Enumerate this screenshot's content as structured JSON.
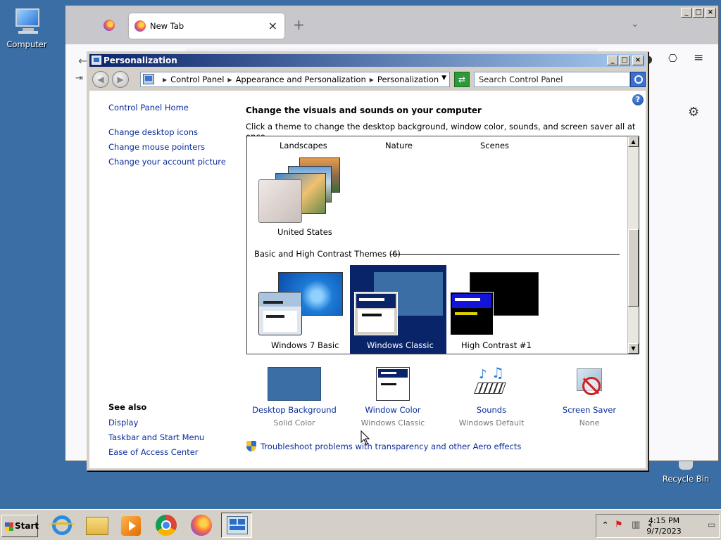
{
  "desktop": {
    "computer_label": "Computer",
    "recycle_label": "Recycle Bin"
  },
  "browser": {
    "tab_title": "New Tab"
  },
  "window": {
    "title": "Personalization",
    "breadcrumb": [
      "Control Panel",
      "Appearance and Personalization",
      "Personalization"
    ],
    "search_placeholder": "Search Control Panel"
  },
  "sidebar": {
    "home": "Control Panel Home",
    "links": [
      "Change desktop icons",
      "Change mouse pointers",
      "Change your account picture"
    ],
    "see_also_title": "See also",
    "see_also": [
      "Display",
      "Taskbar and Start Menu",
      "Ease of Access Center"
    ]
  },
  "main": {
    "heading": "Change the visuals and sounds on your computer",
    "subheading": "Click a theme to change the desktop background, window color, sounds, and screen saver all at once.",
    "categories": [
      "Landscapes",
      "Nature",
      "Scenes"
    ],
    "united_states_label": "United States",
    "basic_group_label": "Basic and High Contrast Themes (6)",
    "basic_themes": [
      "Windows 7 Basic",
      "Windows Classic",
      "High Contrast #1"
    ],
    "selected_theme": "Windows Classic"
  },
  "settings": [
    {
      "label": "Desktop Background",
      "value": "Solid Color"
    },
    {
      "label": "Window Color",
      "value": "Windows Classic"
    },
    {
      "label": "Sounds",
      "value": "Windows Default"
    },
    {
      "label": "Screen Saver",
      "value": "None"
    }
  ],
  "troubleshoot": "Troubleshoot problems with transparency and other Aero effects",
  "taskbar": {
    "start_label": "Start",
    "time": "4:15 PM",
    "date": "9/7/2023"
  },
  "colors": {
    "desktop": "#3a6ea5",
    "selection": "#0a246a",
    "link": "#0b2c9c",
    "classic_blue": "#3a6ea5"
  }
}
